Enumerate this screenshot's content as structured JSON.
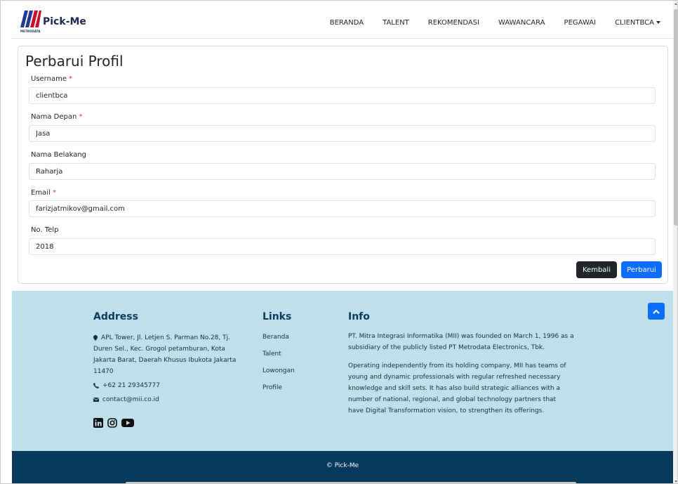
{
  "brand": {
    "name": "Pick-Me",
    "sub": "METRODATA",
    "logo_colors": [
      "#1f3a93",
      "#c8102e"
    ]
  },
  "nav": {
    "items": [
      "BERANDA",
      "TALENT",
      "REKOMENDASI",
      "WAWANCARA",
      "PEGAWAI"
    ],
    "user_menu": "CLIENTBCA"
  },
  "form": {
    "title": "Perbarui Profil",
    "required_mark": "*",
    "fields": [
      {
        "label": "Username",
        "required": true,
        "value": "clientbca"
      },
      {
        "label": "Nama Depan",
        "required": true,
        "value": "Jasa"
      },
      {
        "label": "Nama Belakang",
        "required": false,
        "value": "Raharja"
      },
      {
        "label": "Email",
        "required": true,
        "value": "farizjatmikov@gmail.com"
      },
      {
        "label": "No. Telp",
        "required": false,
        "value": "2018"
      }
    ],
    "back_label": "Kembali",
    "submit_label": "Perbarui"
  },
  "footer": {
    "address": {
      "title": "Address",
      "lines": [
        "APL Tower, Jl. Letjen S. Parman No.28, Tj.",
        "Duren Sel., Kec. Grogol petamburan, Kota",
        "Jakarta Barat, Daerah Khusus Ibukota Jakarta",
        "11470"
      ],
      "phone": "+62 21 29345777",
      "email": "contact@mii.co.id",
      "social_icons": [
        "linkedin-icon",
        "instagram-icon",
        "youtube-icon"
      ]
    },
    "links": {
      "title": "Links",
      "items": [
        "Beranda",
        "Talent",
        "Lowongan",
        "Profile"
      ]
    },
    "info": {
      "title": "Info",
      "p1_lines": [
        "PT. Mitra Integrasi Informatika (MII) was founded on March 1, 1996 as a",
        "subsidiary of the publicly listed PT Metrodata Electronics, Tbk."
      ],
      "p2_lines": [
        "Operating independently from its holding company, MII has teams of",
        "young and dynamic professionals with regular refreshed necessary",
        "knowledge and skill sets. It has also build strategic alliances with a",
        "number of national, regional, and global technology partners that",
        "have Digital Transformation vision, to strengthen its offerings."
      ]
    },
    "copyright": "© Pick-Me"
  },
  "colors": {
    "primary": "#0d6efd",
    "dark": "#212529",
    "footer_bg": "#bfe0ea",
    "copy_bg": "#073a5c",
    "required": "#dc3545"
  }
}
